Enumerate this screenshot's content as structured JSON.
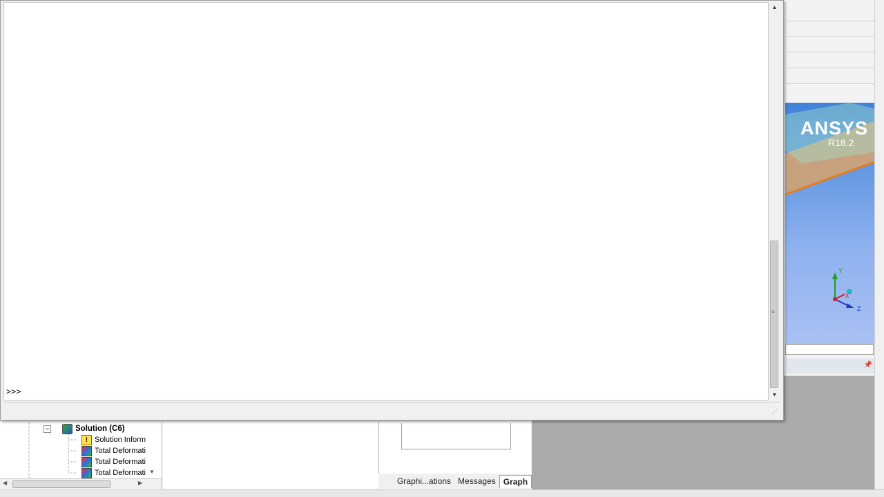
{
  "viewport": {
    "logo_text": "ANSYS",
    "version": "R18.2",
    "triad": {
      "x": "X",
      "y": "Y",
      "z": "Z"
    }
  },
  "tree": {
    "items": [
      {
        "label": "Solution (C6)",
        "icon": "solution-icon"
      },
      {
        "label": "Solution Inform",
        "icon": "solution-information-icon"
      },
      {
        "label": "Total Deformati",
        "icon": "total-deformation-icon"
      },
      {
        "label": "Total Deformati",
        "icon": "total-deformation-icon"
      },
      {
        "label": "Total Deformati",
        "icon": "total-deformation-icon"
      }
    ]
  },
  "tabs": [
    {
      "label": "Graphi...ations"
    },
    {
      "label": "Messages"
    },
    {
      "label": "Graph",
      "active": true
    }
  ],
  "console": {
    "prompt": ">>>"
  },
  "colors": {
    "viewport_top": "#3f83d8",
    "viewport_bottom": "#a9c0f2",
    "model_fill": "#c8a27f",
    "model_edge": "#e57b1f"
  }
}
